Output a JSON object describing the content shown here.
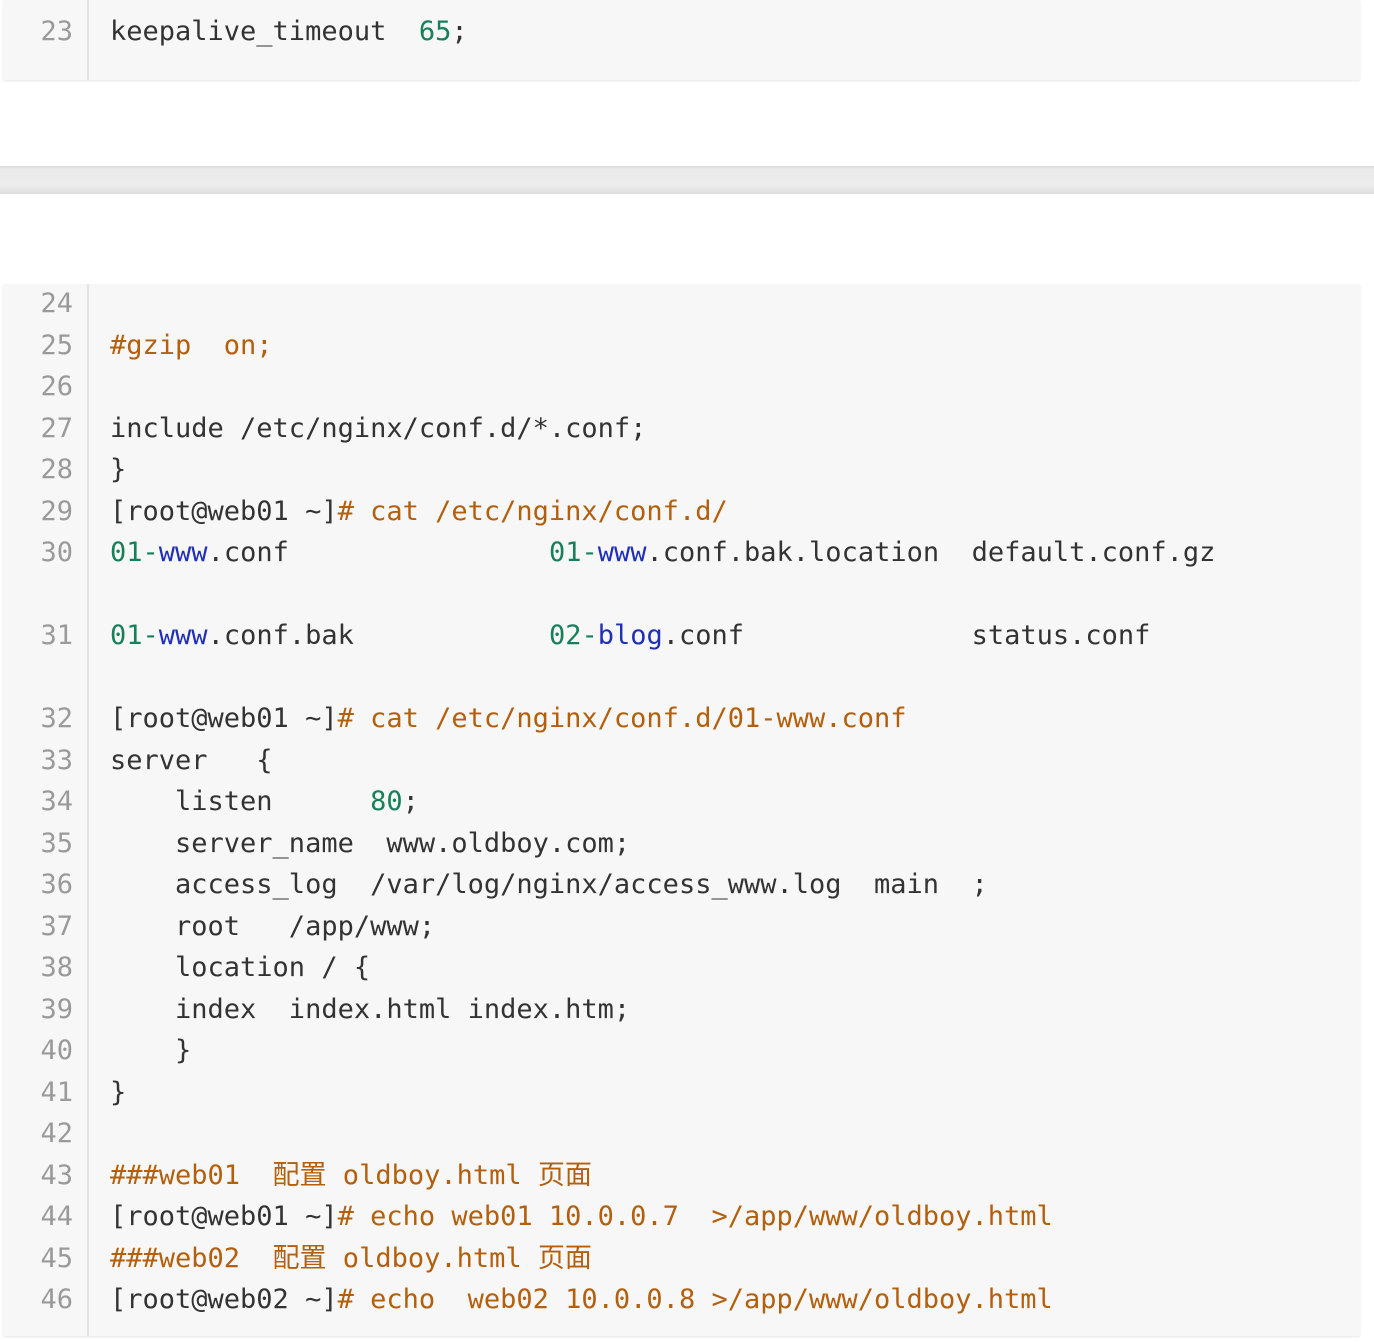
{
  "block_top": {
    "lines": [
      {
        "num": "23",
        "segments": [
          {
            "text": "keepalive_timeout  ",
            "color": "k"
          },
          {
            "text": "65",
            "color": "g"
          },
          {
            "text": ";",
            "color": "k"
          }
        ]
      }
    ]
  },
  "block_main": {
    "lines": [
      {
        "num": "24",
        "segments": []
      },
      {
        "num": "25",
        "segments": [
          {
            "text": "#gzip  on;",
            "color": "o"
          }
        ]
      },
      {
        "num": "26",
        "segments": []
      },
      {
        "num": "27",
        "segments": [
          {
            "text": "include /etc/nginx/conf.d/*.conf;",
            "color": "k"
          }
        ]
      },
      {
        "num": "28",
        "segments": [
          {
            "text": "}",
            "color": "k"
          }
        ]
      },
      {
        "num": "29",
        "segments": [
          {
            "text": "[root@web01 ~]",
            "color": "k"
          },
          {
            "text": "# cat /etc/nginx/conf.d/",
            "color": "o"
          }
        ]
      },
      {
        "num": "30",
        "segments": [
          {
            "text": "01-",
            "color": "g"
          },
          {
            "text": "www",
            "color": "b"
          },
          {
            "text": ".conf                ",
            "color": "k"
          },
          {
            "text": "01-",
            "color": "g"
          },
          {
            "text": "www",
            "color": "b"
          },
          {
            "text": ".conf.bak.location  default.conf.gz",
            "color": "k"
          }
        ]
      },
      {
        "num": "31",
        "segments": [
          {
            "text": "01-",
            "color": "g"
          },
          {
            "text": "www",
            "color": "b"
          },
          {
            "text": ".conf.bak            ",
            "color": "k"
          },
          {
            "text": "02-",
            "color": "g"
          },
          {
            "text": "blog",
            "color": "b"
          },
          {
            "text": ".conf              status.conf",
            "color": "k"
          }
        ]
      },
      {
        "num": "32",
        "segments": [
          {
            "text": "[root@web01 ~]",
            "color": "k"
          },
          {
            "text": "# cat /etc/nginx/conf.d/01-www.conf",
            "color": "o"
          }
        ]
      },
      {
        "num": "33",
        "segments": [
          {
            "text": "server   {",
            "color": "k"
          }
        ]
      },
      {
        "num": "34",
        "segments": [
          {
            "text": "    listen      ",
            "color": "k"
          },
          {
            "text": "80",
            "color": "g"
          },
          {
            "text": ";",
            "color": "k"
          }
        ]
      },
      {
        "num": "35",
        "segments": [
          {
            "text": "    server_name  www.oldboy.com;",
            "color": "k"
          }
        ]
      },
      {
        "num": "36",
        "segments": [
          {
            "text": "    access_log  /var/log/nginx/access_www.log  main  ;",
            "color": "k"
          }
        ]
      },
      {
        "num": "37",
        "segments": [
          {
            "text": "    root   /app/www;",
            "color": "k"
          }
        ]
      },
      {
        "num": "38",
        "segments": [
          {
            "text": "    location / {",
            "color": "k"
          }
        ]
      },
      {
        "num": "39",
        "segments": [
          {
            "text": "    index  index.html index.htm;",
            "color": "k"
          }
        ]
      },
      {
        "num": "40",
        "segments": [
          {
            "text": "    }",
            "color": "k"
          }
        ]
      },
      {
        "num": "41",
        "segments": [
          {
            "text": "}",
            "color": "k"
          }
        ]
      },
      {
        "num": "42",
        "segments": []
      },
      {
        "num": "43",
        "segments": [
          {
            "text": "###web01  配置 oldboy.html 页面",
            "color": "o"
          }
        ]
      },
      {
        "num": "44",
        "segments": [
          {
            "text": "[root@web01 ~]",
            "color": "k"
          },
          {
            "text": "# echo web01 10.0.0.7  >/app/www/oldboy.html",
            "color": "o"
          }
        ]
      },
      {
        "num": "45",
        "segments": [
          {
            "text": "###web02  配置 oldboy.html 页面",
            "color": "o"
          }
        ]
      },
      {
        "num": "46",
        "segments": [
          {
            "text": "[root@web02 ~]",
            "color": "k"
          },
          {
            "text": "# echo  web02 10.0.0.8 >/app/www/oldboy.html",
            "color": "o"
          }
        ]
      }
    ]
  }
}
